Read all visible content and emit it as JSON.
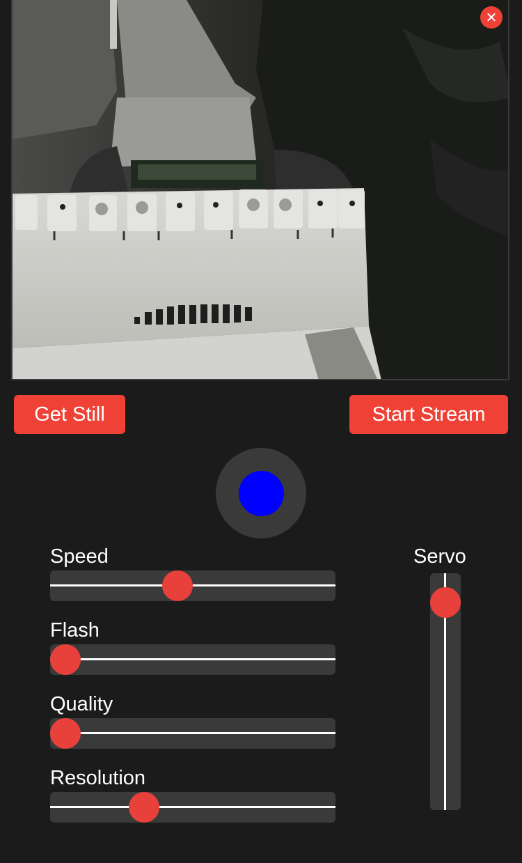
{
  "camera": {
    "close_icon": "✕"
  },
  "buttons": {
    "get_still": "Get Still",
    "start_stream": "Start Stream"
  },
  "joystick": {
    "knob_color": "#0000ff"
  },
  "sliders": {
    "speed": {
      "label": "Speed",
      "value": 0.44
    },
    "flash": {
      "label": "Flash",
      "value": 0.0
    },
    "quality": {
      "label": "Quality",
      "value": 0.0
    },
    "resolution": {
      "label": "Resolution",
      "value": 0.31
    }
  },
  "servo": {
    "label": "Servo",
    "value": 0.0
  },
  "colors": {
    "accent": "#ef4136",
    "background": "#1b1b1c",
    "track": "#3a3a3b"
  }
}
